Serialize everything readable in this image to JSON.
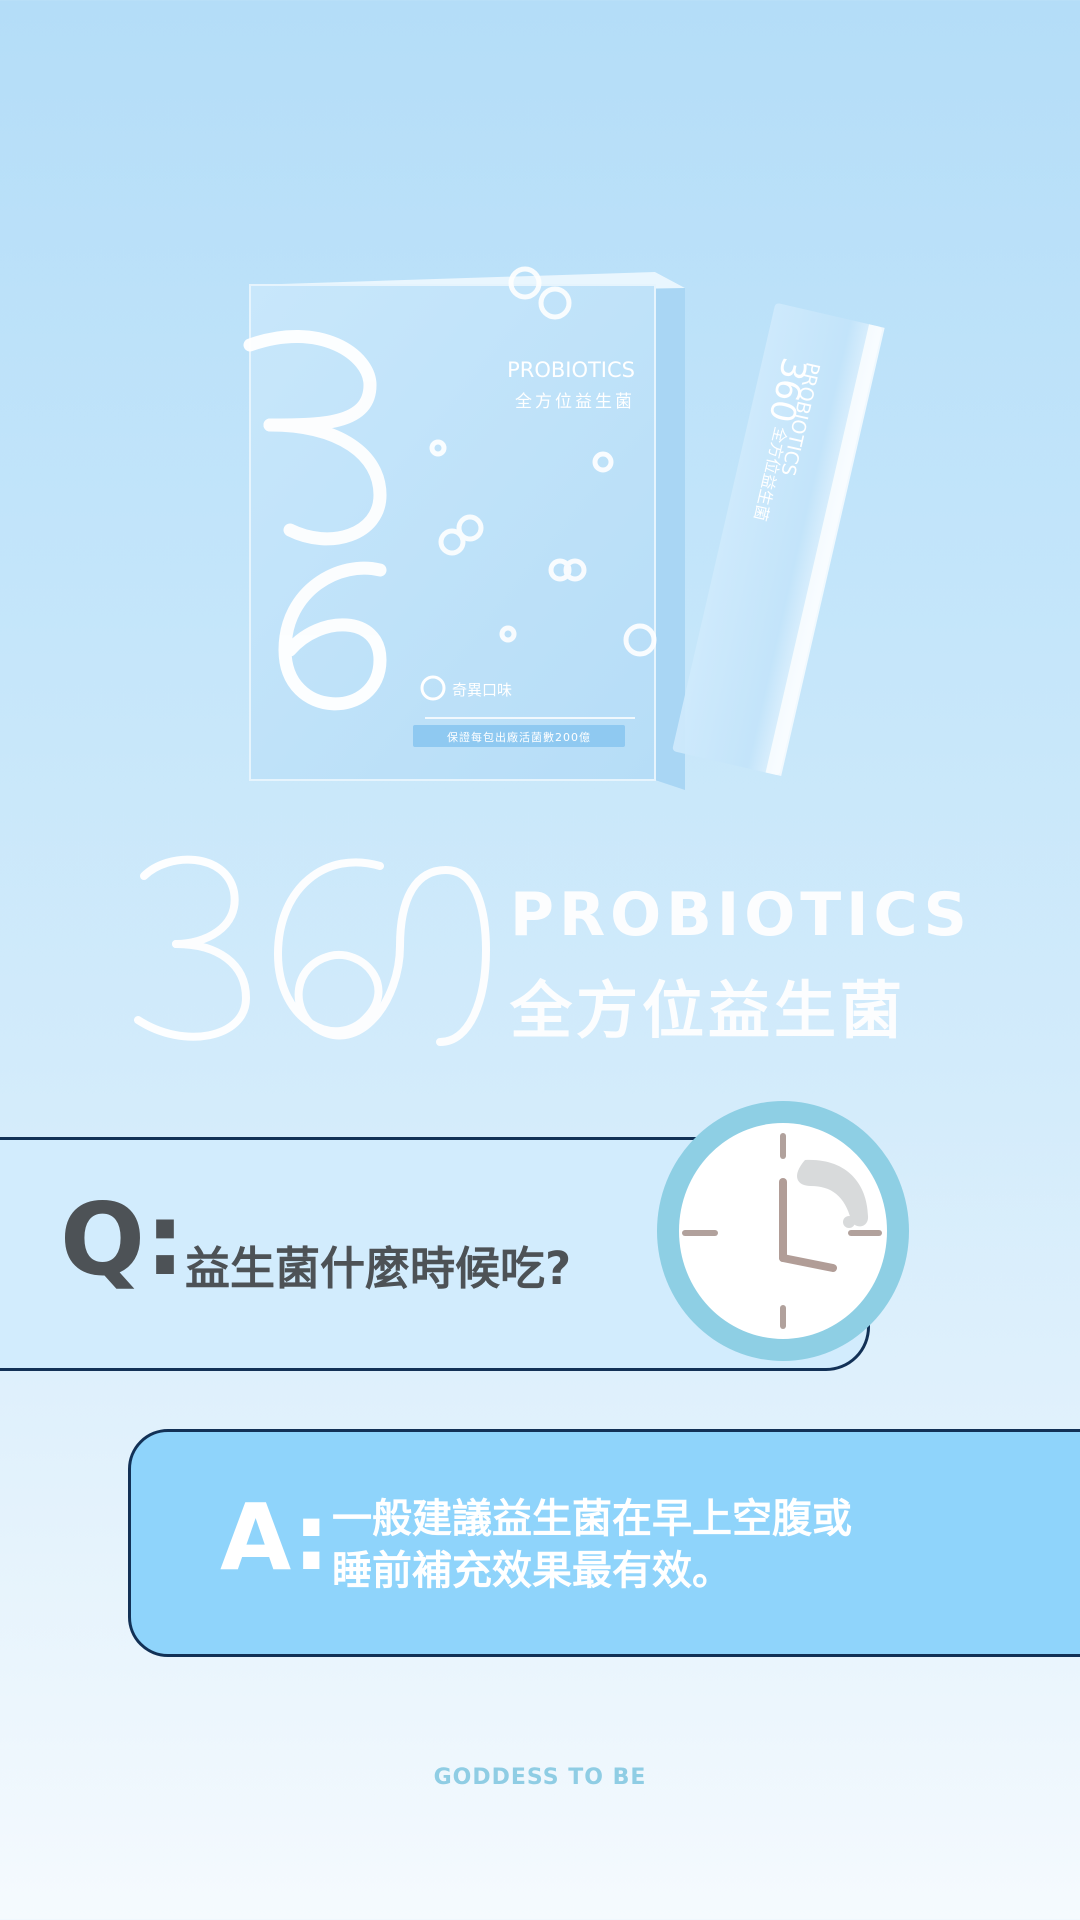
{
  "product": {
    "box_number": "360",
    "box_brand": "PROBIOTICS",
    "box_name": "全方位益生菌",
    "box_flavor": "奇異口味",
    "box_claim": "保證每包出廠活菌數200億",
    "sachet_number": "360",
    "sachet_brand": "PROBIOTICS",
    "sachet_name": "全方位益生菌"
  },
  "hero": {
    "number": "360",
    "word": "PROBIOTICS",
    "cn": "全方位益生菌"
  },
  "question": {
    "letter": "Q:",
    "text": "益生菌什麼時候吃?"
  },
  "answer": {
    "letter": "A:",
    "lines": [
      "一般建議益生菌在早上空腹或",
      "睡前補充效果最有效。"
    ]
  },
  "footer": {
    "brand": "GODDESS TO BE"
  },
  "colors": {
    "question_bg": "#d2ecfd",
    "answer_bg": "#8fd4fb",
    "outline": "#123156",
    "clock_ring": "#8ecfe4",
    "footer_text": "#8fcde4"
  },
  "icons": {
    "clock": "clock-icon"
  }
}
